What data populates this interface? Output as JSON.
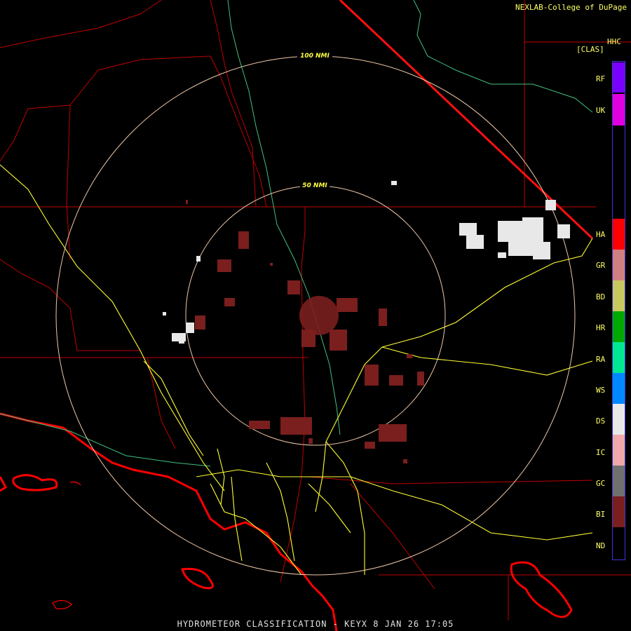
{
  "header": {
    "credit": "NEXLAB-College of DuPage",
    "product_code": "HHC",
    "product_short": "[CLAS]"
  },
  "footer": {
    "title": "HYDROMETEOR CLASSIFICATION - KEYX 8 JAN 26 17:05"
  },
  "range_rings": [
    {
      "label": "100 NMI"
    },
    {
      "label": "50 NMI"
    }
  ],
  "legend": [
    {
      "code": "RF",
      "color": "#7a00ff"
    },
    {
      "code": "UK",
      "color": "#e000e0"
    },
    {
      "code": "HA",
      "color": "#ff0000"
    },
    {
      "code": "GR",
      "color": "#d08080"
    },
    {
      "code": "BD",
      "color": "#c8c860"
    },
    {
      "code": "HR",
      "color": "#00a800"
    },
    {
      "code": "RA",
      "color": "#00e890"
    },
    {
      "code": "WS",
      "color": "#0088ff"
    },
    {
      "code": "DS",
      "color": "#e8e8e8"
    },
    {
      "code": "IC",
      "color": "#f0a8a8"
    },
    {
      "code": "GC",
      "color": "#707070"
    },
    {
      "code": "BI",
      "color": "#7a1e1e"
    },
    {
      "code": "ND",
      "color": "#000000"
    }
  ],
  "colors": {
    "county_lines": "#c00000",
    "coast_lines": "#ff0000",
    "highways": "#ffff33",
    "rivers": "#40c080",
    "range_rings": "#f0c8a8"
  }
}
